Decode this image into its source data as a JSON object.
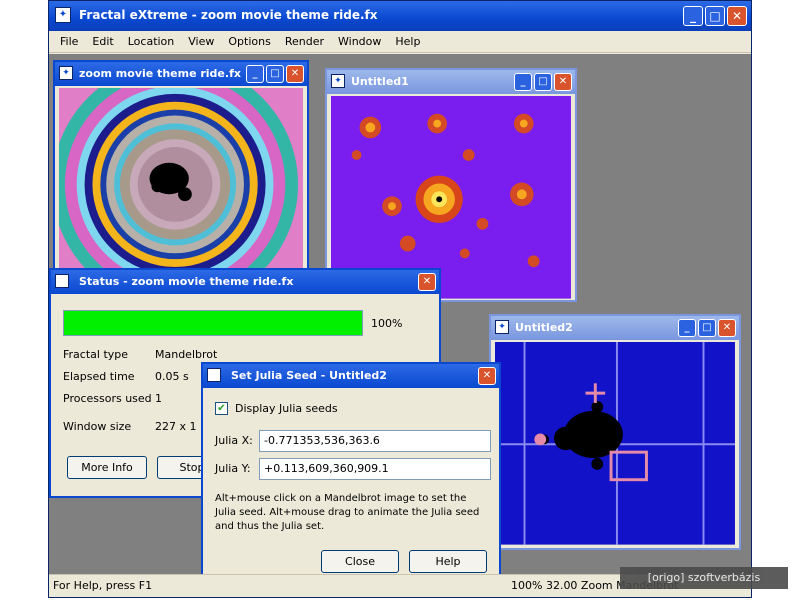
{
  "app": {
    "title": "Fractal eXtreme - zoom movie theme ride.fx",
    "menu": [
      "File",
      "Edit",
      "Location",
      "View",
      "Options",
      "Render",
      "Window",
      "Help"
    ],
    "status_left": "For Help, press F1",
    "status_right": "100%  32.00 Zoom  Mandelbrot"
  },
  "windows": {
    "zoom": {
      "title": "zoom movie theme ride.fx"
    },
    "untitled1": {
      "title": "Untitled1"
    },
    "untitled2": {
      "title": "Untitled2"
    }
  },
  "status_dialog": {
    "title": "Status - zoom movie theme ride.fx",
    "progress": 1.0,
    "progress_label": "100%",
    "progress_color": "#00f000",
    "rows": [
      {
        "label": "Fractal type",
        "value": "Mandelbrot"
      },
      {
        "label": "Elapsed time",
        "value": "0.05 s"
      },
      {
        "label": "Processors used",
        "value": "1"
      },
      {
        "label": "Window size",
        "value": "227 x 1"
      }
    ],
    "buttons": [
      "More Info",
      "Stop"
    ]
  },
  "julia_dialog": {
    "title": "Set Julia Seed - Untitled2",
    "checkbox_label": "Display Julia seeds",
    "checkbox_checked": true,
    "julia_x_label": "Julia X:",
    "julia_x_value": "-0.771353,536,363.6",
    "julia_y_label": "Julia Y:",
    "julia_y_value": "+0.113,609,360,909.1",
    "help_text": "Alt+mouse click on a Mandelbrot image to set the Julia seed. Alt+mouse drag to animate the Julia seed and thus the Julia set.",
    "close_label": "Close",
    "help_label": "Help"
  },
  "watermark": "[origo] szoftverbázis"
}
